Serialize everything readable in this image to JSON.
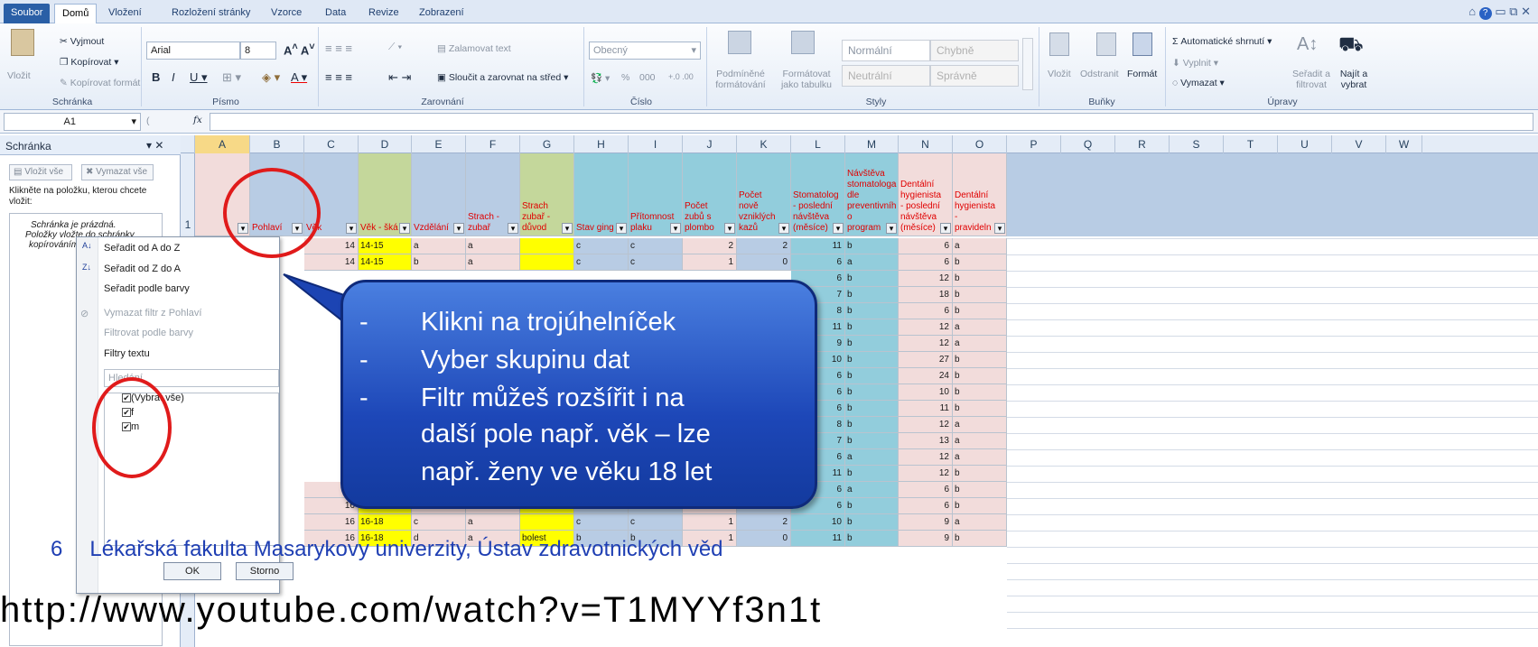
{
  "menu": {
    "file": "Soubor",
    "tabs": [
      "Domů",
      "Vložení",
      "Rozložení stránky",
      "Vzorce",
      "Data",
      "Revize",
      "Zobrazení"
    ]
  },
  "ribbon": {
    "clipboard": {
      "paste": "Vložit",
      "cut": "Vyjmout",
      "copy": "Kopírovat",
      "format_painter": "Kopírovat formát",
      "label": "Schránka"
    },
    "font": {
      "name": "Arial",
      "size": "8",
      "label": "Písmo"
    },
    "alignment": {
      "wrap": "Zalamovat text",
      "merge": "Sloučit a zarovnat na střed",
      "label": "Zarovnání"
    },
    "number": {
      "format": "Obecný",
      "label": "Číslo",
      "percent": "%",
      "thousands": "000"
    },
    "styles": {
      "conditional": "Podmíněné formátování",
      "as_table": "Formátovat jako tabulku",
      "normal": "Normální",
      "bad": "Chybně",
      "neutral": "Neutrální",
      "good": "Správně",
      "label": "Styly"
    },
    "cells": {
      "insert": "Vložit",
      "delete": "Odstranit",
      "format": "Formát",
      "label": "Buňky"
    },
    "editing": {
      "autosum": "Automatické shrnutí",
      "fill": "Vyplnit",
      "clear": "Vymazat",
      "sort": "Seřadit a filtrovat",
      "find": "Najít a vybrat",
      "label": "Úpravy"
    }
  },
  "formula_bar": {
    "name_box": "A1",
    "fx": "fx"
  },
  "pane": {
    "title": "Schránka",
    "paste_all": "Vložit vše",
    "clear_all": "Vymazat vše",
    "instruction": "Klikněte na položku, kterou chcete vložit:",
    "empty1": "Schránka je prázdná.",
    "empty2": "Položky vložte do schránky",
    "empty3": "kopírováním"
  },
  "dropdown": {
    "sort_az": "Seřadit od A do Z",
    "sort_za": "Seřadit od Z do A",
    "sort_color": "Seřadit podle barvy",
    "clear_filter": "Vymazat filtr z Pohlaví",
    "filter_color": "Filtrovat podle barvy",
    "text_filters": "Filtry textu",
    "search": "Hledání",
    "select_all": "(Vybrat vše)",
    "opt_f": "f",
    "opt_m": "m",
    "ok": "OK",
    "cancel": "Storno"
  },
  "columns": [
    "A",
    "B",
    "C",
    "D",
    "E",
    "F",
    "G",
    "H",
    "I",
    "J",
    "K",
    "L",
    "M",
    "N",
    "O",
    "P",
    "Q",
    "R",
    "S",
    "T",
    "U",
    "V",
    "W"
  ],
  "headers": {
    "B": "Pohlaví",
    "C": "Věk",
    "D": "Věk - šká",
    "E": "Vzdělání",
    "F": "Strach - zubař",
    "G": "Strach zubař - důvod",
    "H": "Stav ging",
    "I": "Přítomnost plaku",
    "J": "Počet zubů s plombo",
    "K": "Počet nově vzniklých kazů",
    "L": "Stomatolog - poslední návštěva (měsíce)",
    "M": "Návštěva stomatologa dle preventivníh o program",
    "N": "Dentální hygienista - poslední návštěva (měsíce)",
    "O": "Dentální hygienista - pravideln"
  },
  "row_number": "1",
  "rows": [
    {
      "C": "14",
      "D": "14-15",
      "E": "a",
      "F": "a",
      "G": "",
      "H": "c",
      "I": "c",
      "J": "2",
      "K": "2",
      "L": "11",
      "M": "b",
      "N": "6",
      "O": "a"
    },
    {
      "C": "14",
      "D": "14-15",
      "E": "b",
      "F": "a",
      "G": "",
      "H": "c",
      "I": "c",
      "J": "1",
      "K": "0",
      "L": "6",
      "M": "a",
      "N": "6",
      "O": "b"
    },
    {
      "L": "6",
      "M": "b",
      "N": "12",
      "O": "b"
    },
    {
      "L": "7",
      "M": "b",
      "N": "18",
      "O": "b"
    },
    {
      "L": "8",
      "M": "b",
      "N": "6",
      "O": "b"
    },
    {
      "L": "11",
      "M": "b",
      "N": "12",
      "O": "a"
    },
    {
      "L": "9",
      "M": "b",
      "N": "12",
      "O": "a"
    },
    {
      "L": "10",
      "M": "b",
      "N": "27",
      "O": "b"
    },
    {
      "L": "6",
      "M": "b",
      "N": "24",
      "O": "b"
    },
    {
      "L": "6",
      "M": "b",
      "N": "10",
      "O": "b"
    },
    {
      "L": "6",
      "M": "b",
      "N": "11",
      "O": "b"
    },
    {
      "L": "8",
      "M": "b",
      "N": "12",
      "O": "a"
    },
    {
      "L": "7",
      "M": "b",
      "N": "13",
      "O": "a"
    },
    {
      "L": "6",
      "M": "a",
      "N": "12",
      "O": "a"
    },
    {
      "L": "11",
      "M": "b",
      "N": "12",
      "O": "b"
    },
    {
      "C": "16",
      "D": "16-18",
      "E": "d",
      "F": "a",
      "G": "",
      "H": "b",
      "I": "b",
      "J": "1",
      "K": "1",
      "L": "6",
      "M": "a",
      "N": "6",
      "O": "b"
    },
    {
      "C": "16",
      "D": "16-18",
      "E": "a",
      "F": "b",
      "G": "bolest",
      "H": "c",
      "I": "b",
      "J": "0",
      "K": "0",
      "L": "6",
      "M": "b",
      "N": "6",
      "O": "b"
    },
    {
      "C": "16",
      "D": "16-18",
      "E": "c",
      "F": "a",
      "G": "",
      "H": "c",
      "I": "c",
      "J": "1",
      "K": "2",
      "L": "10",
      "M": "b",
      "N": "9",
      "O": "a"
    },
    {
      "C": "16",
      "D": "16-18",
      "E": "d",
      "F": "a",
      "G": "bolest",
      "H": "b",
      "I": "b",
      "J": "1",
      "K": "0",
      "L": "11",
      "M": "b",
      "N": "9",
      "O": "b"
    }
  ],
  "callout": {
    "line1": "Klikni na trojúhelníček",
    "line2": "Vyber skupinu dat",
    "line3": "Filtr můžeš rozšířit i na",
    "line4": "další pole např. věk – lze",
    "line5": "např. ženy ve věku 18 let"
  },
  "footer": {
    "page": "6",
    "text": "Lékařská fakulta Masarykovy univerzity, Ústav zdravotnických věd"
  },
  "bottom_url": "http://www.youtube.com/watch?v=T1MYYf3n1t",
  "colors": {
    "pink": "#f2dcdb",
    "yellow": "#ffff00",
    "blue": "#b8cce4",
    "cyan": "#92cddc",
    "green": "#c4d79b",
    "callout": "#2a58c8",
    "red": "#e01b1b"
  }
}
